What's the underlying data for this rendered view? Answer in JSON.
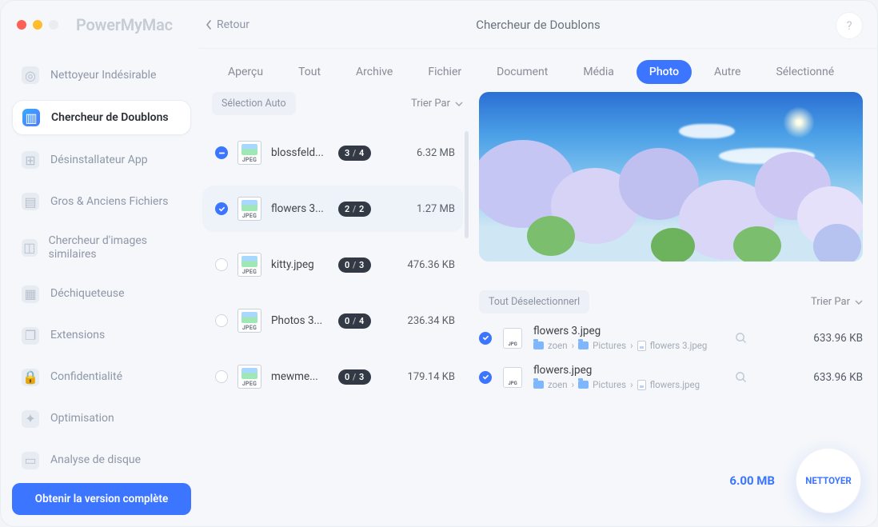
{
  "brand": "PowerMyMac",
  "sidebar": {
    "items": [
      {
        "label": "Nettoyeur Indésirable",
        "icon": "target-icon"
      },
      {
        "label": "Chercheur de Doublons",
        "icon": "files-icon"
      },
      {
        "label": "Désinstallateur App",
        "icon": "app-icon"
      },
      {
        "label": "Gros & Anciens Fichiers",
        "icon": "box-icon"
      },
      {
        "label": "Chercheur d'images similaires",
        "icon": "image-icon"
      },
      {
        "label": "Déchiqueteuse",
        "icon": "shredder-icon"
      },
      {
        "label": "Extensions",
        "icon": "puzzle-icon"
      },
      {
        "label": "Confidentialité",
        "icon": "lock-icon"
      },
      {
        "label": "Optimisation",
        "icon": "rocket-icon"
      },
      {
        "label": "Analyse de disque",
        "icon": "disk-icon"
      }
    ],
    "active": 1,
    "cta": "Obtenir la version complète"
  },
  "header": {
    "back": "Retour",
    "title": "Chercheur de Doublons",
    "help": "?"
  },
  "tabs": {
    "items": [
      "Aperçu",
      "Tout",
      "Archive",
      "Fichier",
      "Document",
      "Média",
      "Photo",
      "Autre",
      "Sélectionné"
    ],
    "active": 6
  },
  "left_toolbar": {
    "auto": "Sélection Auto",
    "sort": "Trier Par"
  },
  "rows": [
    {
      "name": "blossfeld...",
      "badge": "3 / 4",
      "size": "6.32 MB",
      "state": "partial"
    },
    {
      "name": "flowers 3...",
      "badge": "2 / 2",
      "size": "1.27 MB",
      "state": "checked"
    },
    {
      "name": "kitty.jpeg",
      "badge": "0 / 3",
      "size": "476.36 KB",
      "state": "none"
    },
    {
      "name": "Photos 3...",
      "badge": "0 / 4",
      "size": "236.34 KB",
      "state": "none"
    },
    {
      "name": "mewme...",
      "badge": "0 / 3",
      "size": "179.14 KB",
      "state": "none"
    }
  ],
  "thumb_ext": "JPEG",
  "right_toolbar": {
    "deselect": "Tout Déselectionnerl",
    "sort": "Trier Par"
  },
  "dupes": [
    {
      "name": "flowers 3.jpeg",
      "path": [
        "zoen",
        "Pictures",
        "flowers 3.jpeg"
      ],
      "size": "633.96 KB"
    },
    {
      "name": "flowers.jpeg",
      "path": [
        "zoen",
        "Pictures",
        "flowers.jpeg"
      ],
      "size": "633.96 KB"
    }
  ],
  "path_sep": "›",
  "footer": {
    "total": "6.00 MB",
    "clean": "NETTOYER"
  },
  "icon_glyphs": {
    "target-icon": "◎",
    "files-icon": "▥",
    "app-icon": "⊞",
    "box-icon": "▤",
    "image-icon": "◫",
    "shredder-icon": "▦",
    "puzzle-icon": "❐",
    "lock-icon": "🔒",
    "rocket-icon": "✦",
    "disk-icon": "▭"
  }
}
